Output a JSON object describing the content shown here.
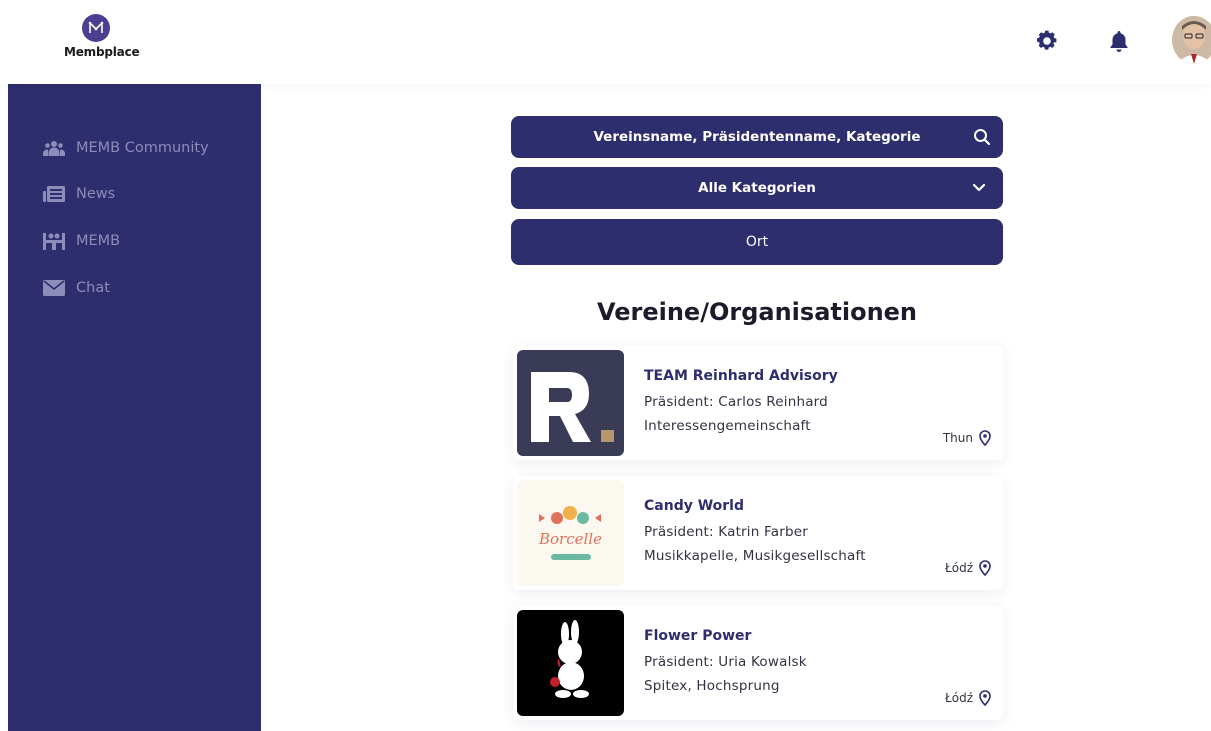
{
  "app": {
    "brand": "Membplace"
  },
  "sidebar": {
    "items": [
      {
        "label": "MEMB Community",
        "icon": "users-icon"
      },
      {
        "label": "News",
        "icon": "newspaper-icon"
      },
      {
        "label": "MEMB",
        "icon": "meeting-icon"
      },
      {
        "label": "Chat",
        "icon": "envelope-icon"
      }
    ]
  },
  "search": {
    "text_placeholder": "Vereinsname, Präsidentenname, Kategorie",
    "category_selected": "Alle Kategorien",
    "location_placeholder": "Ort"
  },
  "section": {
    "title": "Vereine/Organisationen"
  },
  "organizations": [
    {
      "name": "TEAM Reinhard Advisory",
      "president": "Präsident: Carlos Reinhard",
      "category": "Interessengemeinschaft",
      "location": "Thun"
    },
    {
      "name": "Candy World",
      "president": "Präsident: Katrin Farber",
      "category": "Musikkapelle, Musikgesellschaft",
      "location": "Łódź",
      "logo_text": "Borcelle"
    },
    {
      "name": "Flower Power",
      "president": "Präsident: Uria Kowalsk",
      "category": "Spitex, Hochsprung",
      "location": "Łódź"
    }
  ],
  "colors": {
    "primary": "#2e2d6e",
    "sidebar_text": "#8e8cb8"
  }
}
